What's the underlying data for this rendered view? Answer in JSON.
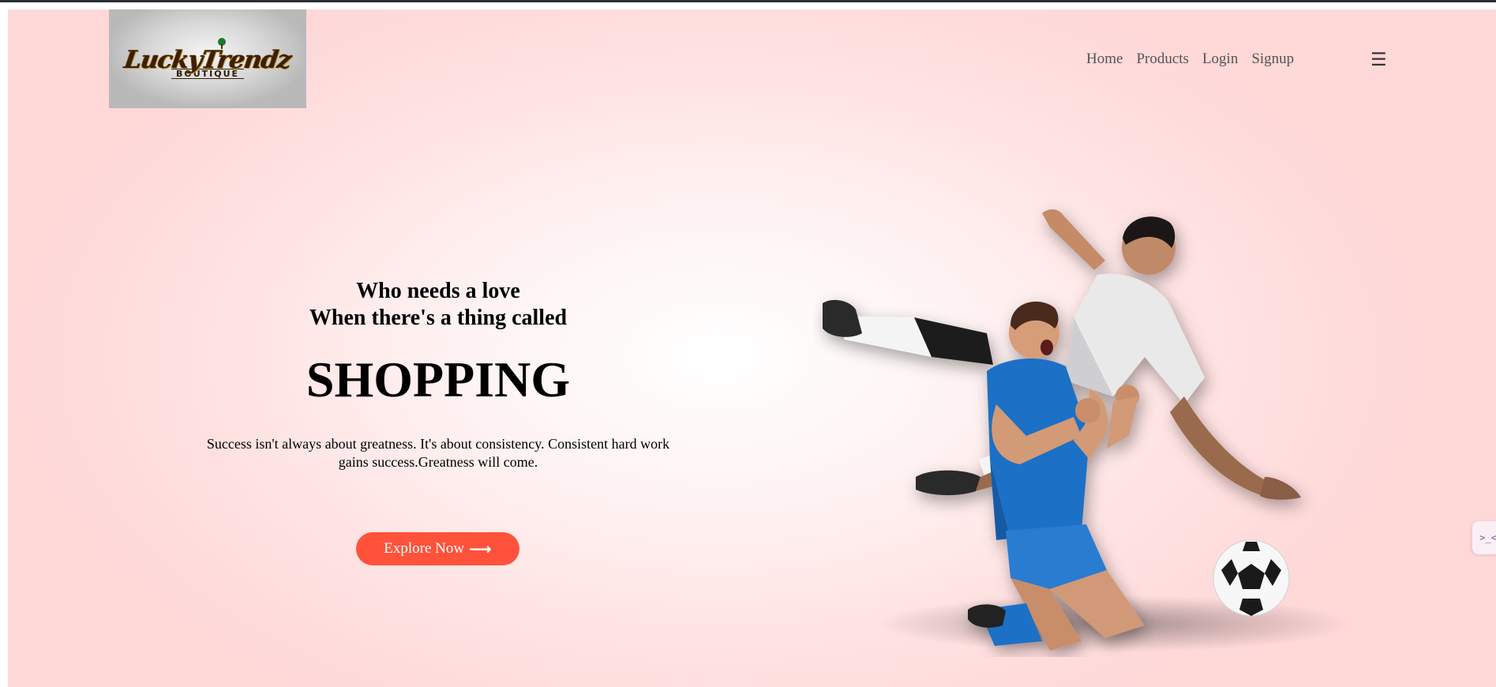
{
  "logo": {
    "brand_text": "LuckyTrendz",
    "sub_text": "BOUTIQUE",
    "icon": "tree-icon"
  },
  "nav": {
    "items": [
      {
        "label": "Home"
      },
      {
        "label": "Products"
      },
      {
        "label": "Login"
      },
      {
        "label": "Signup"
      }
    ],
    "menu_icon": "hamburger-menu-icon"
  },
  "hero": {
    "line1": "Who needs a love",
    "line2": "When there's a thing called",
    "headline": "SHOPPING",
    "description": "Success isn't always about greatness. It's about consistency. Consistent hard work gains success.Greatness will come.",
    "cta_label": "Explore Now",
    "cta_icon": "arrow-right-icon"
  },
  "side_widget": {
    "label": ">_<",
    "icon": "assistant-icon"
  },
  "colors": {
    "accent": "#ff523b",
    "background": "#ffe2e2",
    "nav_text": "#555555"
  }
}
